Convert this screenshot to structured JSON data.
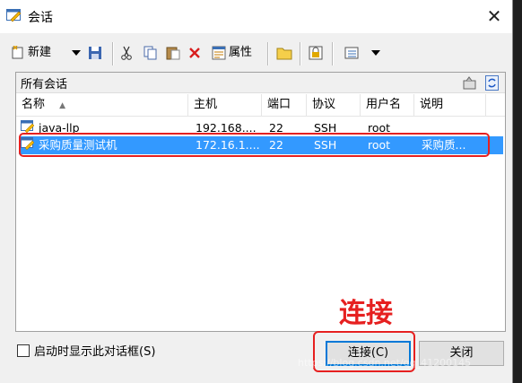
{
  "window": {
    "title": "会话",
    "close_symbol": "✕"
  },
  "toolbar": {
    "new_label": "新建",
    "properties_label": "属性",
    "icons": [
      "new-session-icon",
      "dropdown-arrow-icon",
      "save-icon",
      "cut-icon",
      "copy-icon",
      "paste-icon",
      "delete-icon",
      "properties-icon",
      "folder-icon",
      "lock-icon",
      "view-icon",
      "dropdown-arrow-icon"
    ]
  },
  "panel": {
    "title": "所有会话"
  },
  "columns": [
    "名称",
    "主机",
    "端口",
    "协议",
    "用户名",
    "说明"
  ],
  "sort_symbol": "▲",
  "sessions": [
    {
      "name": "java-llp",
      "host": "192.168....",
      "port": "22",
      "protocol": "SSH",
      "user": "root",
      "note": "",
      "selected": false
    },
    {
      "name": "采购质量测试机",
      "host": "172.16.1....",
      "port": "22",
      "protocol": "SSH",
      "user": "root",
      "note": "采购质...",
      "selected": true
    }
  ],
  "annotation": "连接",
  "footer": {
    "show_on_startup_label": "启动时显示此对话框(S)",
    "connect_label": "连接(C)",
    "close_label": "关闭"
  },
  "watermark": "https://blog.csdn.net/qq_41200145",
  "colors": {
    "selection": "#3399ff",
    "highlight": "#e62020"
  }
}
